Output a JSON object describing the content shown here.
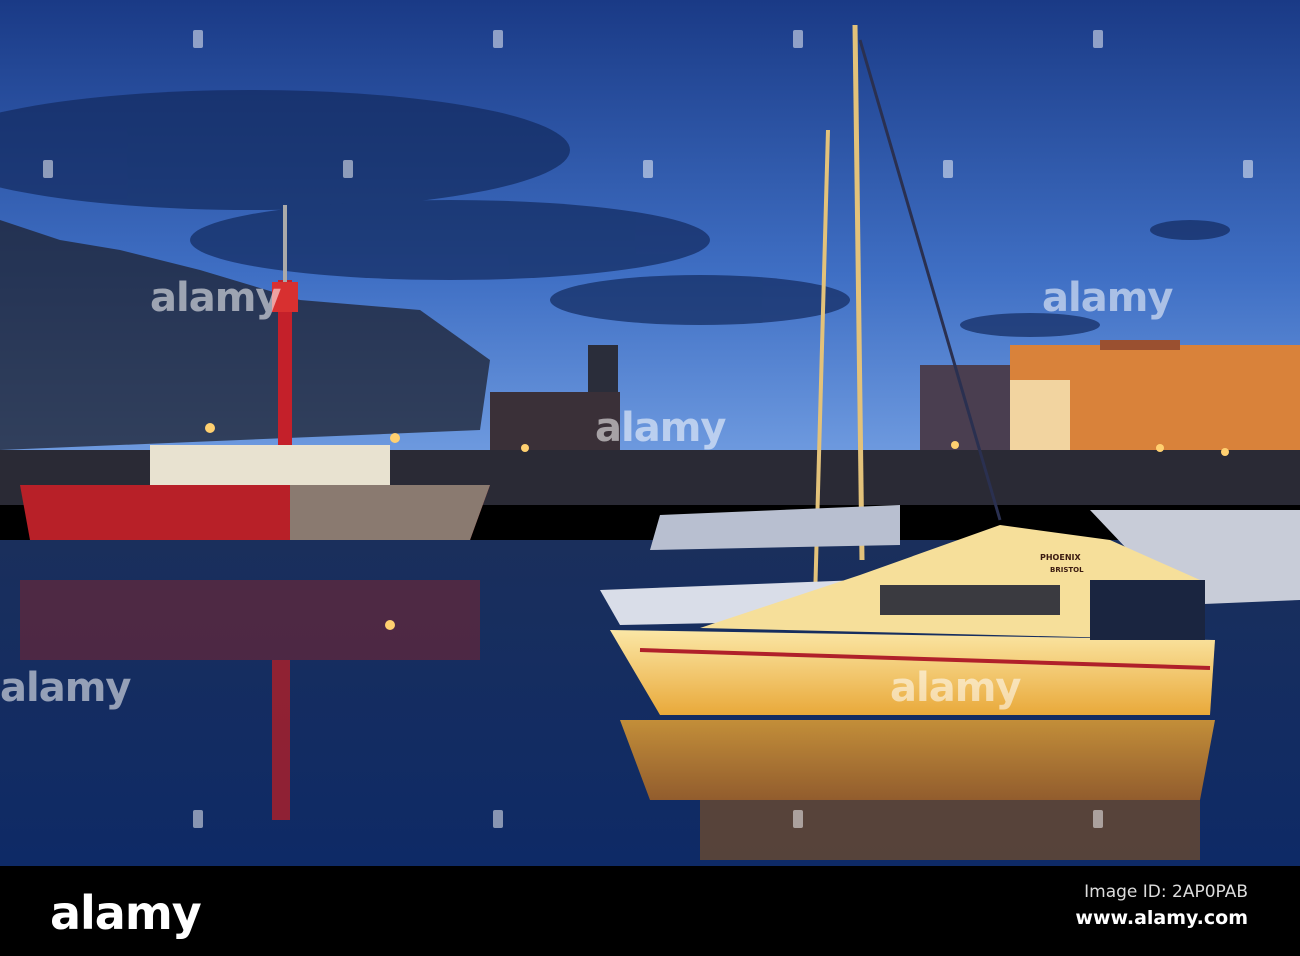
{
  "photo": {
    "subject": "Bristol harbour marina at dusk",
    "boat_name": "PHOENIX",
    "boat_home_port": "BRISTOL",
    "watermark": "alamy"
  },
  "footer": {
    "logo": "alamy",
    "image_id": "Image ID: 2AP0PAB",
    "url": "www.alamy.com"
  },
  "colors": {
    "sky_top": "#14306e",
    "sky_horizon": "#6f9be0",
    "water": "#0f2450",
    "boat": "#f2c24a",
    "buildings": "#e08a3a"
  }
}
